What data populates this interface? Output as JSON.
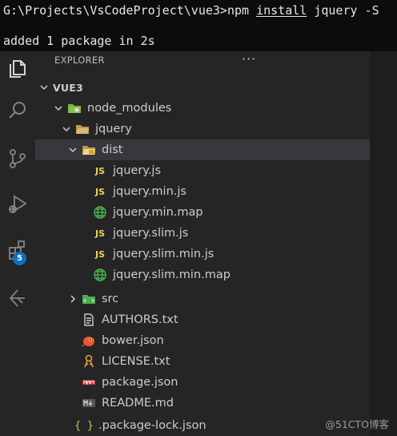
{
  "terminal": {
    "prompt": "G:\\Projects\\VsCodeProject\\vue3>",
    "cmd1": "npm ",
    "cmd2": "install",
    "cmd3": " jquery -S",
    "output": "added 1 package in 2s"
  },
  "activity_bar": {
    "items": [
      "explorer-icon",
      "search-icon",
      "source-control-icon",
      "run-debug-icon",
      "extensions-icon",
      "remote-icon"
    ],
    "extensions_badge": "5",
    "accent": "#0e70c0"
  },
  "explorer": {
    "title": "EXPLORER",
    "more": "···",
    "root": "VUE3",
    "tree": {
      "node_modules": "node_modules",
      "jquery": "jquery",
      "dist": "dist",
      "dist_files": [
        "jquery.js",
        "jquery.min.js",
        "jquery.min.map",
        "jquery.slim.js",
        "jquery.slim.min.js",
        "jquery.slim.min.map"
      ],
      "src": "src",
      "authors": "AUTHORS.txt",
      "bower": "bower.json",
      "license": "LICENSE.txt",
      "package": "package.json",
      "readme": "README.md",
      "lock": ".package-lock.json"
    },
    "icons": {
      "js": "JS",
      "braces": "{ }"
    }
  },
  "watermark": "@51CTO博客"
}
